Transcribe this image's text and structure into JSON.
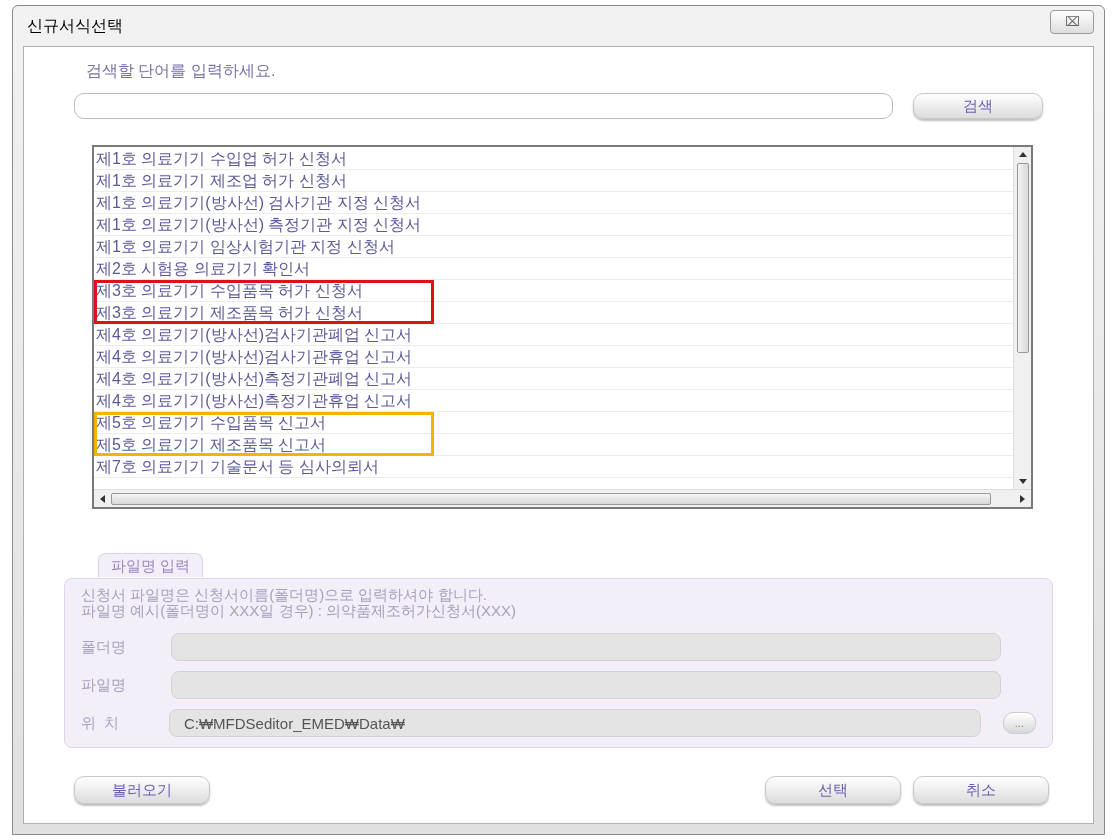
{
  "window": {
    "title": "신규서식선택",
    "close": "⌧"
  },
  "search": {
    "label": "검색할 단어를 입력하세요.",
    "button": "검색"
  },
  "list": {
    "items": [
      {
        "text": "제1호 의료기기 수입업 허가 신청서"
      },
      {
        "text": "제1호 의료기기 제조업 허가 신청서"
      },
      {
        "text": "제1호 의료기기(방사선) 검사기관 지정 신청서"
      },
      {
        "text": "제1호 의료기기(방사선) 측정기관 지정 신청서"
      },
      {
        "text": "제1호 의료기기 임상시험기관 지정 신청서"
      },
      {
        "text": "제2호 시험용 의료기기 확인서"
      },
      {
        "text": "제3호 의료기기 수입품목 허가 신청서",
        "color": "#e0101a"
      },
      {
        "text": "제3호 의료기기 제조품목 허가 신청서",
        "color": "#e0101a"
      },
      {
        "text": "제4호 의료기기(방사선)검사기관폐업 신고서"
      },
      {
        "text": "제4호 의료기기(방사선)검사기관휴업 신고서"
      },
      {
        "text": "제4호 의료기기(방사선)측정기관폐업 신고서"
      },
      {
        "text": "제4호 의료기기(방사선)측정기관휴업 신고서"
      },
      {
        "text": "제5호 의료기기 수입품목 신고서",
        "color": "#f5b400"
      },
      {
        "text": "제5호 의료기기 제조품목 신고서",
        "color": "#f5b400"
      },
      {
        "text": "제7호 의료기기 기술문서 등 심사의뢰서"
      }
    ]
  },
  "file_panel": {
    "tab": "파일명 입력",
    "notes": [
      "신청서 파일명은 신청서이름(폴더명)으로 입력하셔야 합니다.",
      "파일명 예시(폴더명이 XXX일 경우) : 의약품제조허가신청서(XXX)"
    ],
    "fields": [
      {
        "label": "폴더명"
      },
      {
        "label": "파일명"
      },
      {
        "label": "위  치",
        "value": "C:₩MFDSeditor_EMED₩Data₩",
        "browse": "..."
      }
    ]
  },
  "buttons": {
    "load": "불러오기",
    "select": "선택",
    "cancel": "취소"
  }
}
